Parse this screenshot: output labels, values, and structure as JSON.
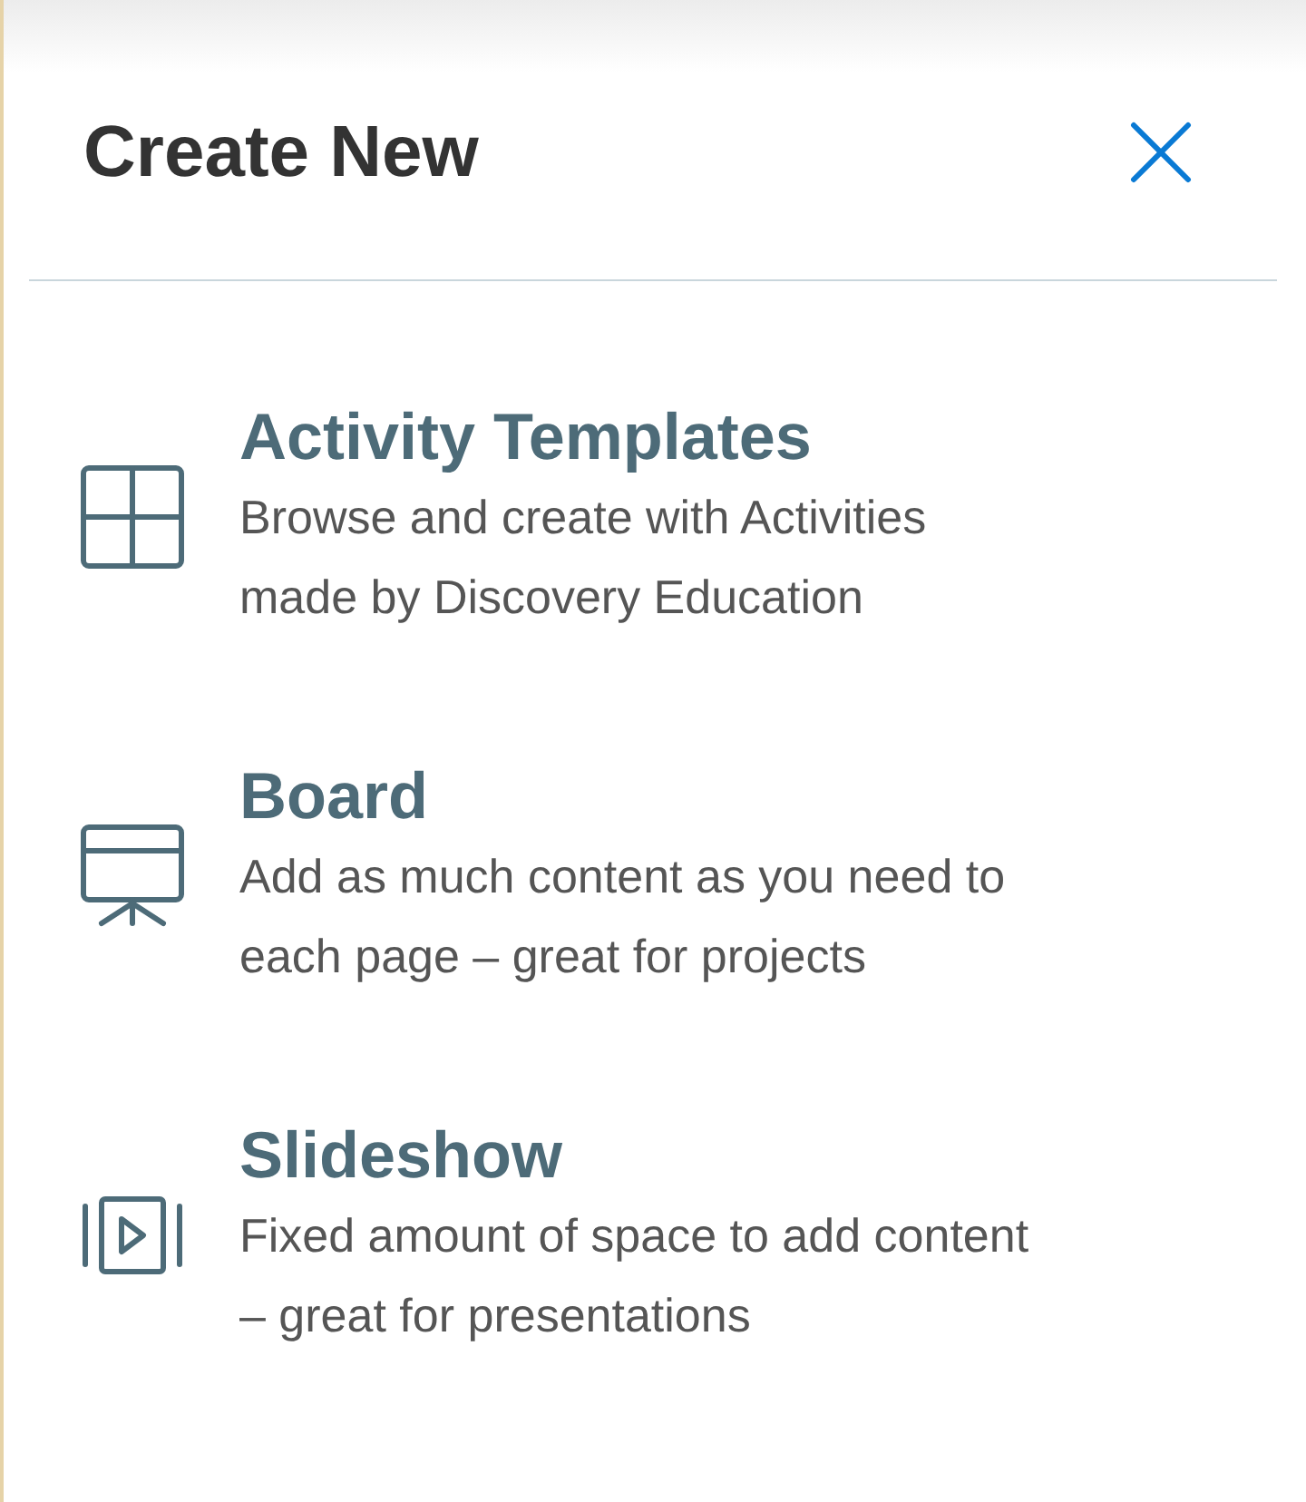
{
  "header": {
    "title": "Create New"
  },
  "options": [
    {
      "kind": "grid",
      "title": "Activity Templates",
      "description": "Browse and create with Activities made by Discovery Education"
    },
    {
      "kind": "board",
      "title": "Board",
      "description": "Add as much content as you need to each page – great for projects"
    },
    {
      "kind": "slideshow",
      "title": "Slideshow",
      "description": "Fixed amount of space to add content – great for presentations"
    }
  ]
}
